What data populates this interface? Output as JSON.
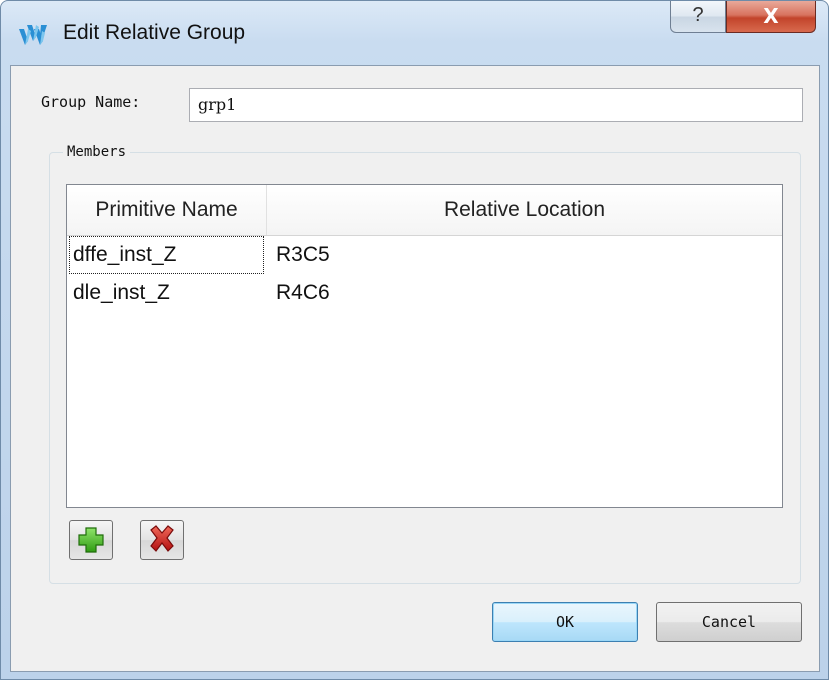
{
  "window": {
    "title": "Edit Relative Group",
    "help_glyph": "?",
    "close_glyph": "X",
    "app_icon": "gowin-logo-icon"
  },
  "form": {
    "group_name_label": "Group Name:",
    "group_name_value": "grp1"
  },
  "members": {
    "legend": "Members",
    "columns": [
      "Primitive Name",
      "Relative Location"
    ],
    "rows": [
      {
        "primitive": "dffe_inst_Z",
        "location": "R3C5"
      },
      {
        "primitive": "dle_inst_Z",
        "location": "R4C6"
      }
    ],
    "add_icon": "plus-icon",
    "delete_icon": "delete-x-icon"
  },
  "buttons": {
    "ok": "OK",
    "cancel": "Cancel"
  },
  "colors": {
    "add_green": "#3fb11f",
    "delete_red": "#d41a1a",
    "ok_border": "#3c7fb1"
  }
}
